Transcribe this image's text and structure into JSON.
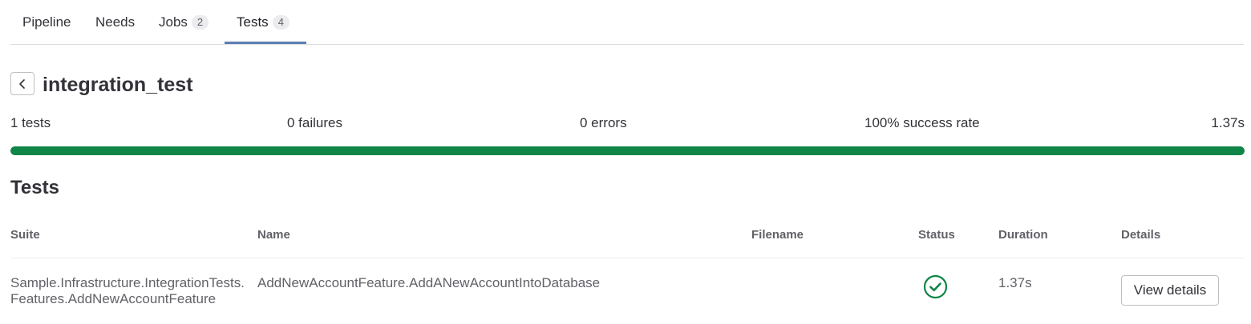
{
  "tabs": [
    {
      "label": "Pipeline",
      "count": null
    },
    {
      "label": "Needs",
      "count": null
    },
    {
      "label": "Jobs",
      "count": "2"
    },
    {
      "label": "Tests",
      "count": "4",
      "active": true
    }
  ],
  "job": {
    "title": "integration_test"
  },
  "summary": {
    "tests": "1 tests",
    "failures": "0 failures",
    "errors": "0 errors",
    "success_rate": "100% success rate",
    "duration": "1.37s",
    "success_fraction": 1.0
  },
  "section": {
    "title": "Tests"
  },
  "table": {
    "headers": [
      "Suite",
      "Name",
      "Filename",
      "Status",
      "Duration",
      "Details"
    ],
    "rows": [
      {
        "suite_line1": "Sample.Infrastructure.IntegrationTests.",
        "suite_line2": "Features.AddNewAccountFeature",
        "name": "AddNewAccountFeature.AddANewAccountIntoDatabase",
        "filename": "",
        "status": "success",
        "duration": "1.37s",
        "details_label": "View details"
      }
    ]
  },
  "icons": {
    "back": "chevron-left-icon",
    "status": "check-circle-icon"
  },
  "colors": {
    "success": "#108548",
    "active_tab": "#5b7fb5"
  }
}
